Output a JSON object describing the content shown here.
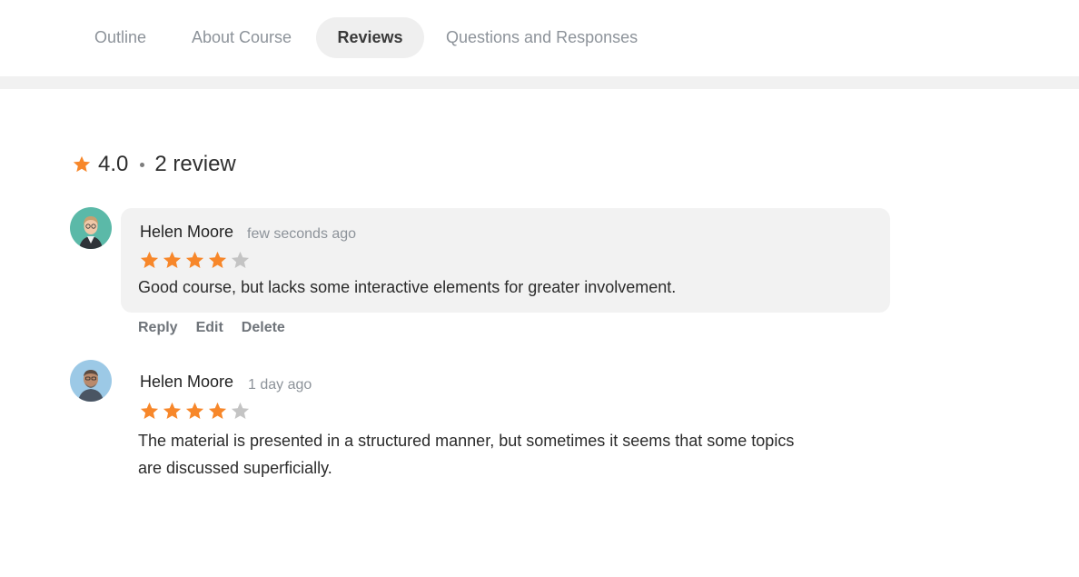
{
  "tabs": [
    {
      "label": "Outline",
      "active": false
    },
    {
      "label": "About Course",
      "active": false
    },
    {
      "label": "Reviews",
      "active": true
    },
    {
      "label": "Questions and Responses",
      "active": false
    }
  ],
  "summary": {
    "rating": "4.0",
    "count_label": "2 review"
  },
  "colors": {
    "star_filled": "#f7872a",
    "star_empty": "#c4c4c4",
    "bubble_bg": "#f2f2f2",
    "active_tab_bg": "#efefef"
  },
  "reviews": [
    {
      "author": "Helen Moore",
      "time": "few seconds ago",
      "rating": 4,
      "max_rating": 5,
      "text": "Good course, but lacks some interactive elements for greater involvement.",
      "actions": {
        "reply": "Reply",
        "edit": "Edit",
        "delete": "Delete"
      }
    },
    {
      "author": "Helen Moore",
      "time": "1 day ago",
      "rating": 4,
      "max_rating": 5,
      "text_line1": "The material is presented in a structured manner, but sometimes it seems that some topics",
      "text_line2": "are discussed superficially."
    }
  ]
}
